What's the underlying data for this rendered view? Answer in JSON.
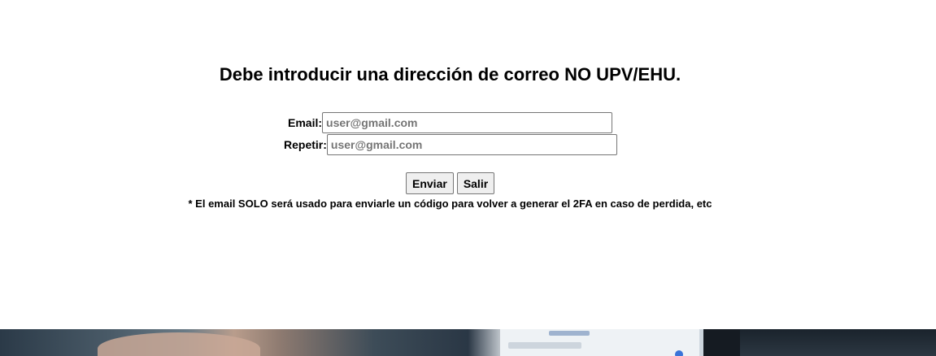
{
  "heading": "Debe introducir una dirección de correo NO UPV/EHU.",
  "form": {
    "email_label": "Email:",
    "email_placeholder": "user@gmail.com",
    "email_value": "",
    "repeat_label": "Repetir:",
    "repeat_placeholder": "user@gmail.com",
    "repeat_value": ""
  },
  "buttons": {
    "send_label": "Enviar",
    "exit_label": "Salir"
  },
  "note": "* El email SOLO será usado para enviarle un código para volver a generar el 2FA en caso de perdida, etc",
  "colors": {
    "background": "#ffffff",
    "text": "#000000",
    "button_bg": "#efefef",
    "input_border": "#767676"
  }
}
